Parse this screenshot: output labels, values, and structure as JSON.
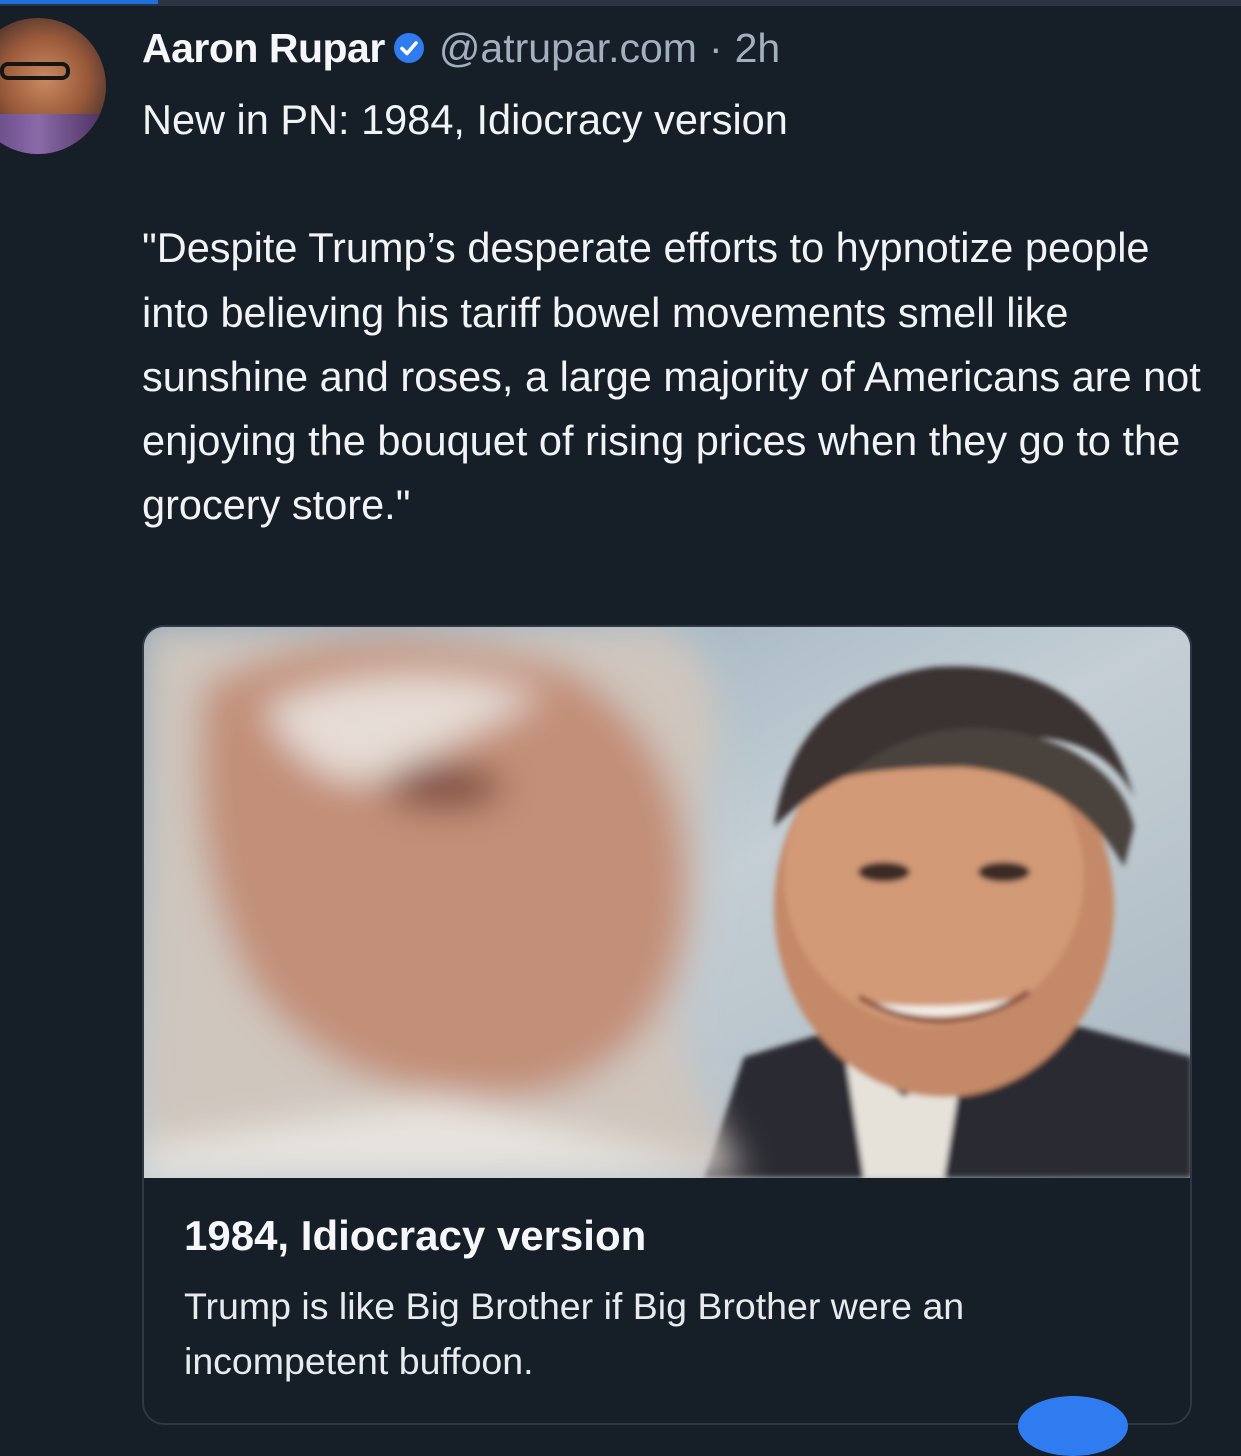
{
  "post": {
    "author_name": "Aaron Rupar",
    "handle": "@atrupar.com",
    "separator": "·",
    "timestamp": "2h",
    "text": "New in PN: 1984, Idiocracy version\n\n\"Despite Trump’s desperate efforts to hypnotize people into believing his tariff bowel movements smell like sunshine and roses, a large majority of Americans are not enjoying the bouquet of rising prices when they go to the grocery store.\""
  },
  "link_card": {
    "title": "1984, Idiocracy version",
    "description": "Trump is like Big Brother if Big Brother were an incompetent buffoon."
  },
  "icons": {
    "verified": "verified-check-icon"
  },
  "colors": {
    "background": "#161e27",
    "accent": "#1f6fe0",
    "verified": "#2f7cf0",
    "secondary_text": "#a2afbd"
  }
}
